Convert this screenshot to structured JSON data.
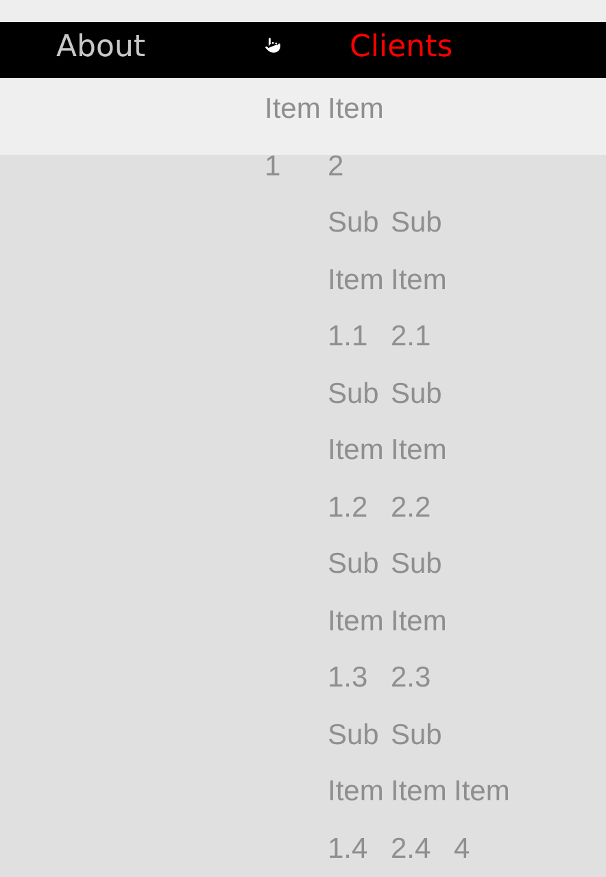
{
  "nav": {
    "items": [
      {
        "label": "About",
        "selected": false
      },
      {
        "label": "Clients",
        "selected": true
      }
    ]
  },
  "dropdown": {
    "items": [
      "Item 1",
      "Item 2",
      "Sub Item 1.1",
      "Sub Item 2.1",
      "Sub Item 1.2",
      "Sub Item 2.2",
      "Sub Item 1.3",
      "Sub Item 2.3",
      "Sub Item 1.4",
      "Sub Item 2.4",
      "Item 4"
    ]
  }
}
